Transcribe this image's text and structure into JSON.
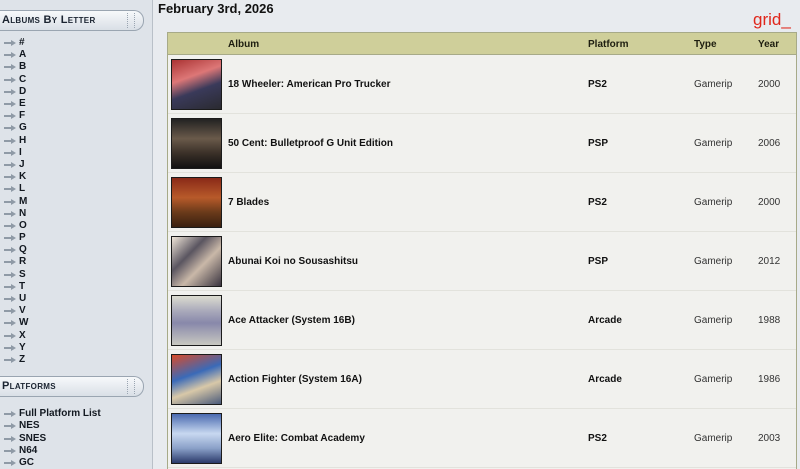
{
  "sidebar": {
    "letters_title": "Albums By Letter",
    "letters": [
      "#",
      "A",
      "B",
      "C",
      "D",
      "E",
      "F",
      "G",
      "H",
      "I",
      "J",
      "K",
      "L",
      "M",
      "N",
      "O",
      "P",
      "Q",
      "R",
      "S",
      "T",
      "U",
      "V",
      "W",
      "X",
      "Y",
      "Z"
    ],
    "platforms_title": "Platforms",
    "platforms": [
      "Full Platform List",
      "NES",
      "SNES",
      "N64",
      "GC"
    ]
  },
  "main": {
    "date": "February 3rd, 2026",
    "overlay_text": "grid_",
    "table": {
      "headers": {
        "album": "Album",
        "platform": "Platform",
        "type": "Type",
        "year": "Year"
      },
      "rows": [
        {
          "album": "18 Wheeler: American Pro Trucker",
          "platform": "PS2",
          "type": "Gamerip",
          "year": "2000"
        },
        {
          "album": "50 Cent: Bulletproof G Unit Edition",
          "platform": "PSP",
          "type": "Gamerip",
          "year": "2006"
        },
        {
          "album": "7 Blades",
          "platform": "PS2",
          "type": "Gamerip",
          "year": "2000"
        },
        {
          "album": "Abunai Koi no Sousashitsu",
          "platform": "PSP",
          "type": "Gamerip",
          "year": "2012"
        },
        {
          "album": "Ace Attacker (System 16B)",
          "platform": "Arcade",
          "type": "Gamerip",
          "year": "1988"
        },
        {
          "album": "Action Fighter (System 16A)",
          "platform": "Arcade",
          "type": "Gamerip",
          "year": "1986"
        },
        {
          "album": "Aero Elite: Combat Academy",
          "platform": "PS2",
          "type": "Gamerip",
          "year": "2003"
        }
      ]
    }
  },
  "colors": {
    "header_bg": "#cfcf9a",
    "sidebar_bg": "#dee3e9",
    "overlay": "#e0261b"
  }
}
